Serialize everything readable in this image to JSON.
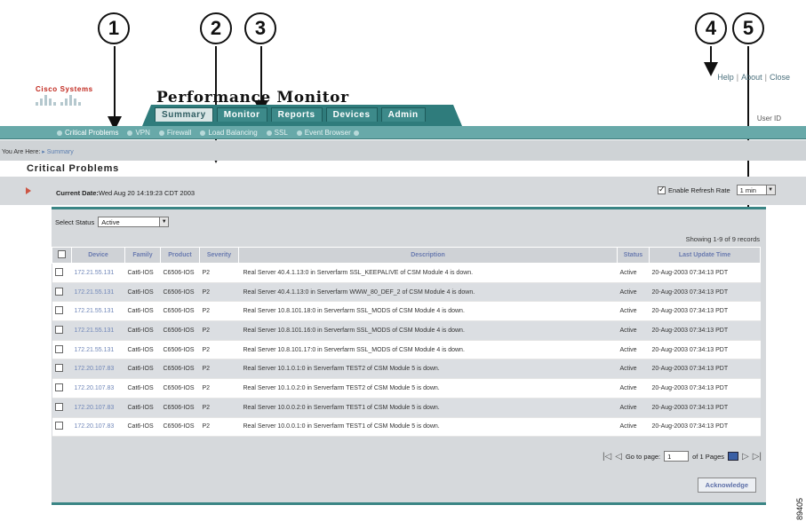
{
  "callouts": [
    "1",
    "2",
    "3",
    "4",
    "5"
  ],
  "header": {
    "logo_text": "Cisco Systems",
    "app_title": "Performance Monitor",
    "links": [
      "Help",
      "About",
      "Close"
    ],
    "user_id_label": "User ID"
  },
  "tabs": [
    {
      "label": "Summary",
      "active": true
    },
    {
      "label": "Monitor",
      "active": false
    },
    {
      "label": "Reports",
      "active": false
    },
    {
      "label": "Devices",
      "active": false
    },
    {
      "label": "Admin",
      "active": false
    }
  ],
  "subnav": [
    {
      "label": "Critical Problems",
      "active": true
    },
    {
      "label": "VPN",
      "active": false
    },
    {
      "label": "Firewall",
      "active": false
    },
    {
      "label": "Load Balancing",
      "active": false
    },
    {
      "label": "SSL",
      "active": false
    },
    {
      "label": "Event Browser",
      "active": false
    }
  ],
  "breadcrumb": {
    "prefix": "You Are Here: ",
    "item": "Summary"
  },
  "page_title": "Critical Problems",
  "current_date": {
    "label": "Current Date:",
    "value": "Wed Aug 20 14:19:23 CDT 2003"
  },
  "refresh": {
    "label": "Enable Refresh Rate",
    "checked": true,
    "rate": "1 min"
  },
  "select_status": {
    "label": "Select Status",
    "value": "Active"
  },
  "showing_text": "Showing 1-9 of 9 records",
  "table": {
    "columns": [
      "Device",
      "Family",
      "Product",
      "Severity",
      "Description",
      "Status",
      "Last Update Time"
    ],
    "rows": [
      [
        "172.21.55.131",
        "Cat6-IOS",
        "C6506-IOS",
        "P2",
        "Real Server 40.4.1.13:0 in Serverfarm SSL_KEEPALIVE of CSM Module 4 is down.",
        "Active",
        "20-Aug-2003 07:34:13 PDT"
      ],
      [
        "172.21.55.131",
        "Cat6-IOS",
        "C6506-IOS",
        "P2",
        "Real Server 40.4.1.13:0 in Serverfarm WWW_80_DEF_2 of CSM Module 4 is down.",
        "Active",
        "20-Aug-2003 07:34:13 PDT"
      ],
      [
        "172.21.55.131",
        "Cat6-IOS",
        "C6506-IOS",
        "P2",
        "Real Server 10.8.101.18:0 in Serverfarm SSL_MODS of CSM Module 4 is down.",
        "Active",
        "20-Aug-2003 07:34:13 PDT"
      ],
      [
        "172.21.55.131",
        "Cat6-IOS",
        "C6506-IOS",
        "P2",
        "Real Server 10.8.101.16:0 in Serverfarm SSL_MODS of CSM Module 4 is down.",
        "Active",
        "20-Aug-2003 07:34:13 PDT"
      ],
      [
        "172.21.55.131",
        "Cat6-IOS",
        "C6506-IOS",
        "P2",
        "Real Server 10.8.101.17:0 in Serverfarm SSL_MODS of CSM Module 4 is down.",
        "Active",
        "20-Aug-2003 07:34:13 PDT"
      ],
      [
        "172.20.107.83",
        "Cat6-IOS",
        "C6506-IOS",
        "P2",
        "Real Server 10.1.0.1:0 in Serverfarm TEST2 of CSM Module 5 is down.",
        "Active",
        "20-Aug-2003 07:34:13 PDT"
      ],
      [
        "172.20.107.83",
        "Cat6-IOS",
        "C6506-IOS",
        "P2",
        "Real Server 10.1.0.2:0 in Serverfarm TEST2 of CSM Module 5 is down.",
        "Active",
        "20-Aug-2003 07:34:13 PDT"
      ],
      [
        "172.20.107.83",
        "Cat6-IOS",
        "C6506-IOS",
        "P2",
        "Real Server 10.0.0.2:0 in Serverfarm TEST1 of CSM Module 5 is down.",
        "Active",
        "20-Aug-2003 07:34:13 PDT"
      ],
      [
        "172.20.107.83",
        "Cat6-IOS",
        "C6506-IOS",
        "P2",
        "Real Server 10.0.0.1:0 in Serverfarm TEST1 of CSM Module 5 is down.",
        "Active",
        "20-Aug-2003 07:34:13 PDT"
      ]
    ]
  },
  "pager": {
    "goto_label": "Go to page:",
    "page_value": "1",
    "of_label": "of 1 Pages"
  },
  "acknowledge_label": "Acknowledge",
  "figure_id": "89405",
  "colors": {
    "teal": "#2f7c7c",
    "teal_light": "#68a9a9",
    "link_blue": "#6f86b8",
    "cisco_red": "#c1281e"
  }
}
